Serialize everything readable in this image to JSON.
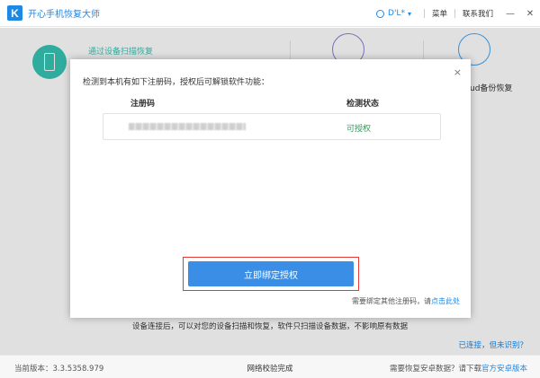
{
  "app": {
    "title": "开心手机恢复大师",
    "logo_letter": "K"
  },
  "titlebar": {
    "user": "D'L*",
    "caret": "▾",
    "menu": "菜单",
    "contact": "联系我们",
    "minimize": "—",
    "close": "✕"
  },
  "modes": {
    "mode1_label": "通过设备扫描恢复",
    "mode3_label": "ud备份恢复"
  },
  "dialog": {
    "message": "检测到本机有如下注册码，授权后可解锁软件功能：",
    "col_code": "注册码",
    "col_status": "检测状态",
    "row_status": "可授权",
    "bind_button": "立即绑定授权",
    "other_prefix": "需要绑定其他注册码，请",
    "other_link": "点击此处",
    "close": "×"
  },
  "page": {
    "hint": "设备连接后，可以对您的设备扫描和恢复，软件只扫描设备数据，不影响原有数据",
    "connected_link": "已连接，但未识别？"
  },
  "statusbar": {
    "version": "当前版本：3.3.5358.979",
    "network": "网络校验完成",
    "android_prefix": "需要恢复安卓数据？请下载",
    "android_link": "官方安卓版本"
  },
  "colors": {
    "accent": "#1e88e5",
    "teal": "#37c4b4",
    "button": "#3a8ee6",
    "ok_green": "#2e9d5a",
    "highlight_red": "#e53935"
  }
}
